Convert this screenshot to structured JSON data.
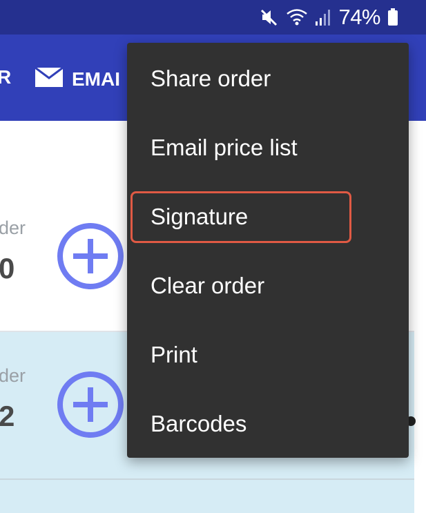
{
  "status_bar": {
    "battery_text": "74%",
    "icons": [
      "mute-icon",
      "wifi-icon",
      "signal-icon",
      "battery-icon"
    ]
  },
  "toolbar": {
    "left_fragment": "R",
    "email_label": "EMAI",
    "icon": "mail-icon"
  },
  "rows": [
    {
      "label": "der",
      "count": "0",
      "icon": "add-circle-icon"
    },
    {
      "label": "der",
      "count": "2",
      "icon": "add-circle-icon"
    }
  ],
  "menu": {
    "items": [
      {
        "label": "Share order"
      },
      {
        "label": "Email price list"
      },
      {
        "label": "Signature",
        "highlighted": true
      },
      {
        "label": "Clear order"
      },
      {
        "label": "Print"
      },
      {
        "label": "Barcodes"
      }
    ]
  },
  "colors": {
    "status_bar": "#25308f",
    "toolbar": "#3140b8",
    "menu_bg": "#313131",
    "highlight": "#e05a44",
    "add_icon": "#6f7cf2",
    "row_alt": "#d6ecf5"
  }
}
